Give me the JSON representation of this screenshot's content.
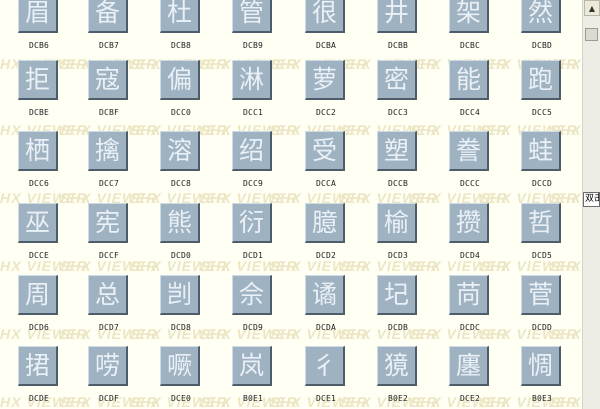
{
  "watermark": "SHX VIEWER",
  "colors": {
    "background": "#fffff4",
    "tile": "#9fb2c2",
    "glyph": "#e9f0f6",
    "watermark": "#ece6c4"
  },
  "rows": [
    [
      {
        "glyph": "眉",
        "code": "DCB6"
      },
      {
        "glyph": "备",
        "code": "DCB7"
      },
      {
        "glyph": "杜",
        "code": "DCB8"
      },
      {
        "glyph": "管",
        "code": "DCB9"
      },
      {
        "glyph": "很",
        "code": "DCBA"
      },
      {
        "glyph": "井",
        "code": "DCBB"
      },
      {
        "glyph": "架",
        "code": "DCBC"
      },
      {
        "glyph": "然",
        "code": "DCBD"
      }
    ],
    [
      {
        "glyph": "拒",
        "code": "DCBE"
      },
      {
        "glyph": "寇",
        "code": "DCBF"
      },
      {
        "glyph": "偏",
        "code": "DCC0"
      },
      {
        "glyph": "淋",
        "code": "DCC1"
      },
      {
        "glyph": "萝",
        "code": "DCC2"
      },
      {
        "glyph": "密",
        "code": "DCC3"
      },
      {
        "glyph": "能",
        "code": "DCC4"
      },
      {
        "glyph": "跑",
        "code": "DCC5"
      }
    ],
    [
      {
        "glyph": "栖",
        "code": "DCC6"
      },
      {
        "glyph": "擒",
        "code": "DCC7"
      },
      {
        "glyph": "溶",
        "code": "DCC8"
      },
      {
        "glyph": "绍",
        "code": "DCC9"
      },
      {
        "glyph": "受",
        "code": "DCCA"
      },
      {
        "glyph": "塑",
        "code": "DCCB"
      },
      {
        "glyph": "誊",
        "code": "DCCC"
      },
      {
        "glyph": "蛙",
        "code": "DCCD"
      }
    ],
    [
      {
        "glyph": "巫",
        "code": "DCCE"
      },
      {
        "glyph": "宪",
        "code": "DCCF"
      },
      {
        "glyph": "熊",
        "code": "DCD0"
      },
      {
        "glyph": "衍",
        "code": "DCD1"
      },
      {
        "glyph": "臆",
        "code": "DCD2"
      },
      {
        "glyph": "榆",
        "code": "DCD3"
      },
      {
        "glyph": "攒",
        "code": "DCD4"
      },
      {
        "glyph": "哲",
        "code": "DCD5"
      }
    ],
    [
      {
        "glyph": "周",
        "code": "DCD6"
      },
      {
        "glyph": "总",
        "code": "DCD7"
      },
      {
        "glyph": "剀",
        "code": "DCD8"
      },
      {
        "glyph": "佘",
        "code": "DCD9"
      },
      {
        "glyph": "谲",
        "code": "DCDA"
      },
      {
        "glyph": "圮",
        "code": "DCDB"
      },
      {
        "glyph": "苘",
        "code": "DCDC"
      },
      {
        "glyph": "菅",
        "code": "DCDD"
      }
    ],
    [
      {
        "glyph": "捃",
        "code": "DCDE"
      },
      {
        "glyph": "唠",
        "code": "DCDF"
      },
      {
        "glyph": "噘",
        "code": "DCE0"
      },
      {
        "glyph": "岚",
        "code": "B0E1"
      },
      {
        "glyph": "彳",
        "code": "DCE1"
      },
      {
        "glyph": "獍",
        "code": "B0E2"
      },
      {
        "glyph": "廛",
        "code": "DCE2"
      },
      {
        "glyph": "惆",
        "code": "B0E3"
      }
    ]
  ],
  "tooltip": "双击"
}
